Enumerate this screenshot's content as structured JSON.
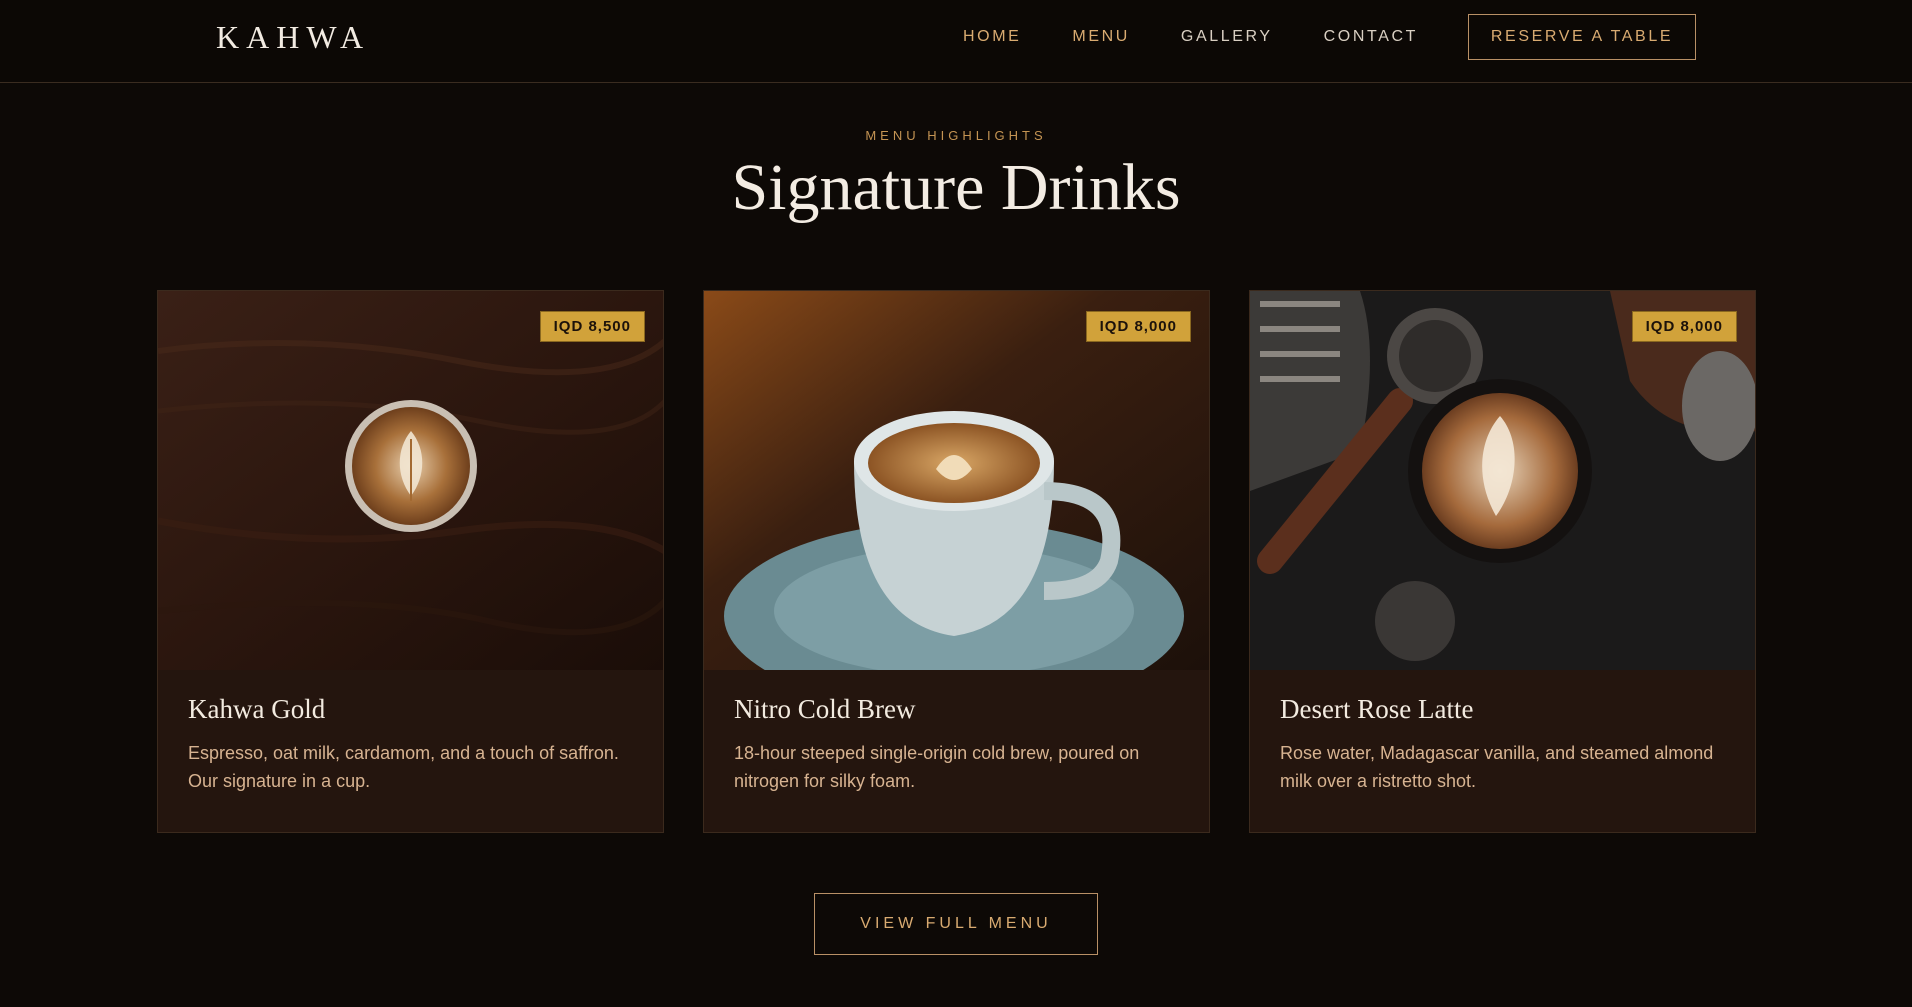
{
  "brand": {
    "logo": "KAHWA"
  },
  "nav": {
    "items": [
      "HOME",
      "MENU",
      "GALLERY",
      "CONTACT"
    ],
    "reserve_label": "RESERVE A TABLE"
  },
  "section": {
    "eyebrow": "MENU HIGHLIGHTS",
    "title": "Signature Drinks"
  },
  "cards": [
    {
      "name": "Kahwa Gold",
      "price": "IQD 8,500",
      "description": "Espresso, oat milk, cardamom, and a touch of saffron. Our signature in a cup."
    },
    {
      "name": "Nitro Cold Brew",
      "price": "IQD 8,000",
      "description": "18-hour steeped single-origin cold brew, poured on nitrogen for silky foam."
    },
    {
      "name": "Desert Rose Latte",
      "price": "IQD 8,000",
      "description": "Rose water, Madagascar vanilla, and steamed almond milk over a ristretto shot."
    }
  ],
  "cta": {
    "full_menu_label": "VIEW FULL MENU"
  },
  "colors": {
    "background": "#0d0906",
    "accent": "#d9ab71",
    "price_badge": "#d1a23a",
    "card_body": "#24150e"
  }
}
